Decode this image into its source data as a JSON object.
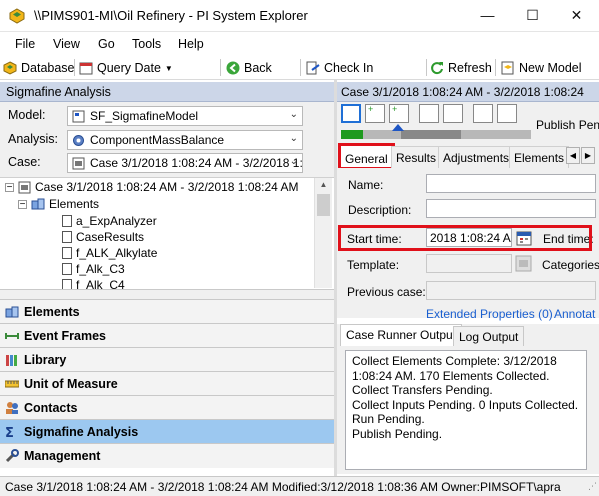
{
  "window": {
    "title": "\\\\PIMS901-MI\\Oil Refinery - PI System Explorer",
    "minimize": "—",
    "maximize": "☐",
    "close": "✕"
  },
  "menu": [
    "File",
    "View",
    "Go",
    "Tools",
    "Help"
  ],
  "toolbar": {
    "database": "Database",
    "query_date": "Query Date",
    "back": "Back",
    "check_in": "Check In",
    "refresh": "Refresh",
    "new_model": "New Model"
  },
  "left": {
    "header": "Sigmafine Analysis",
    "model_label": "Model:",
    "model_value": "SF_SigmafineModel",
    "analysis_label": "Analysis:",
    "analysis_value": "ComponentMassBalance",
    "case_label": "Case:",
    "case_value": "Case 3/1/2018 1:08:24 AM - 3/2/2018 1:",
    "tree": {
      "root": "Case 3/1/2018 1:08:24 AM - 3/2/2018 1:08:24 AM",
      "elements": "Elements",
      "items": [
        "a_ExpAnalyzer",
        "CaseResults",
        "f_ALK_Alkylate",
        "f_Alk_C3",
        "f_Alk_C4"
      ]
    },
    "nav": [
      "Elements",
      "Event Frames",
      "Library",
      "Unit of Measure",
      "Contacts",
      "Sigmafine Analysis",
      "Management"
    ]
  },
  "right": {
    "header": "Case 3/1/2018 1:08:24 AM - 3/2/2018 1:08:24",
    "publish_label": "Publish Pend",
    "tabs": [
      "General",
      "Results",
      "Adjustments",
      "Elements"
    ],
    "name_label": "Name:",
    "description_label": "Description:",
    "start_label": "Start time:",
    "start_value": "2018 1:08:24 AM",
    "end_label": "End time:",
    "template_label": "Template:",
    "categories_label": "Categories",
    "previous_label": "Previous case:",
    "ext_props": "Extended Properties (0)",
    "annotations": "Annotat",
    "output_tabs": [
      "Case Runner Output",
      "Log Output"
    ],
    "output_text": "Collect Elements Complete: 3/12/2018 1:08:24 AM. 170 Elements Collected.\nCollect Transfers Pending.\nCollect Inputs Pending. 0 Inputs Collected.\nRun Pending.\nPublish Pending."
  },
  "status": "Case 3/1/2018 1:08:24 AM - 3/2/2018 1:08:24 AM  Modified:3/12/2018 1:08:36 AM Owner:PIMSOFT\\apra"
}
